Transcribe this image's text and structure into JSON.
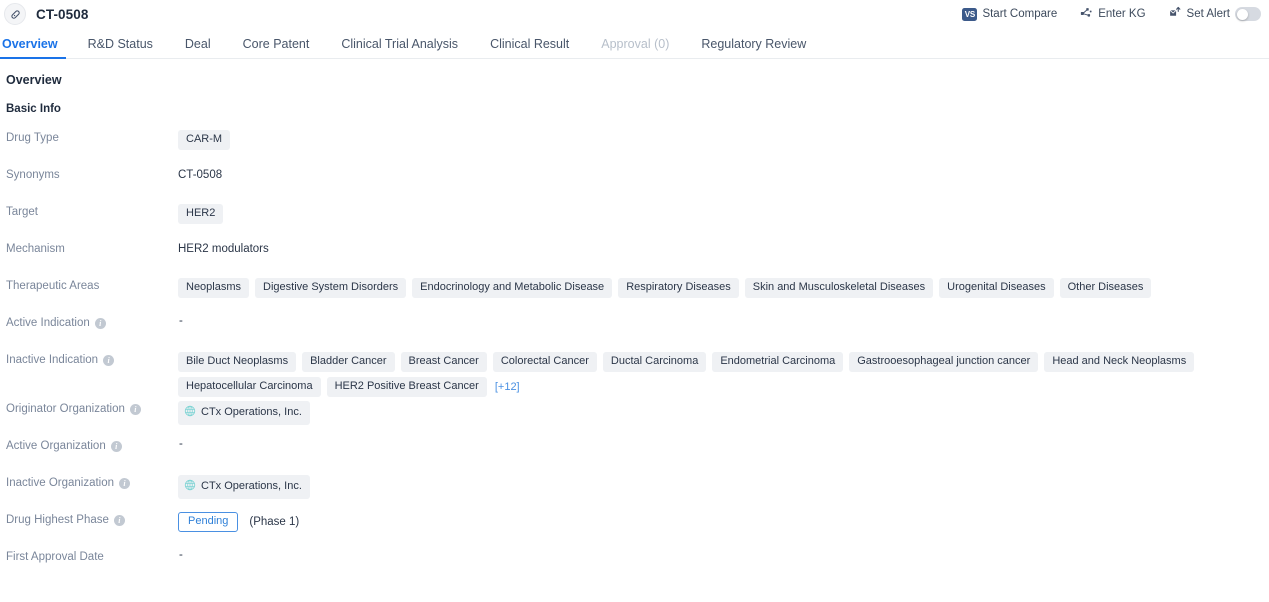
{
  "header": {
    "drug_icon": "pill-icon",
    "title": "CT-0508",
    "actions": [
      {
        "id": "start-compare",
        "icon": "vs-badge-icon",
        "label": "Start Compare"
      },
      {
        "id": "enter-kg",
        "icon": "knowledge-graph-icon",
        "label": "Enter KG"
      },
      {
        "id": "set-alert",
        "icon": "alert-bell-icon",
        "label": "Set Alert",
        "toggle_on": false
      }
    ]
  },
  "tabs": [
    {
      "label": "Overview",
      "active": true,
      "disabled": false
    },
    {
      "label": "R&D Status",
      "active": false,
      "disabled": false
    },
    {
      "label": "Deal",
      "active": false,
      "disabled": false
    },
    {
      "label": "Core Patent",
      "active": false,
      "disabled": false
    },
    {
      "label": "Clinical Trial Analysis",
      "active": false,
      "disabled": false
    },
    {
      "label": "Clinical Result",
      "active": false,
      "disabled": false
    },
    {
      "label": "Approval (0)",
      "active": false,
      "disabled": true
    },
    {
      "label": "Regulatory Review",
      "active": false,
      "disabled": false
    }
  ],
  "overview": {
    "section_title": "Overview",
    "basic_info_title": "Basic Info",
    "labels": {
      "drug_type": "Drug Type",
      "synonyms": "Synonyms",
      "target": "Target",
      "mechanism": "Mechanism",
      "therapeutic_areas": "Therapeutic Areas",
      "active_indication": "Active Indication",
      "inactive_indication": "Inactive Indication",
      "originator_organization": "Originator Organization",
      "active_organization": "Active Organization",
      "inactive_organization": "Inactive Organization",
      "drug_highest_phase": "Drug Highest Phase",
      "first_approval_date": "First Approval Date"
    },
    "drug_type": [
      "CAR-M"
    ],
    "synonyms": "CT-0508",
    "target": [
      "HER2"
    ],
    "mechanism": "HER2 modulators",
    "therapeutic_areas": [
      "Neoplasms",
      "Digestive System Disorders",
      "Endocrinology and Metabolic Disease",
      "Respiratory Diseases",
      "Skin and Musculoskeletal Diseases",
      "Urogenital Diseases",
      "Other Diseases"
    ],
    "active_indication": "-",
    "inactive_indication": [
      "Bile Duct Neoplasms",
      "Bladder Cancer",
      "Breast Cancer",
      "Colorectal Cancer",
      "Ductal Carcinoma",
      "Endometrial Carcinoma",
      "Gastrooesophageal junction cancer",
      "Head and Neck Neoplasms",
      "Hepatocellular Carcinoma",
      "HER2 Positive Breast Cancer"
    ],
    "inactive_indication_more": "[+12]",
    "originator_organization": [
      "CTx Operations, Inc."
    ],
    "active_organization": "-",
    "inactive_organization": [
      "CTx Operations, Inc."
    ],
    "drug_highest_phase_badge": "Pending",
    "drug_highest_phase_note": "(Phase 1)",
    "first_approval_date": "-"
  },
  "colors": {
    "accent_blue": "#1a73e8",
    "link_blue": "#4a90e2",
    "label_gray": "#7a869a",
    "value_dark": "#2b3648",
    "tag_bg": "#eff1f4",
    "org_icon_teal": "#7fd4d4",
    "vs_badge": "#3c5a8a",
    "toggle_off": "#d6dae1"
  }
}
